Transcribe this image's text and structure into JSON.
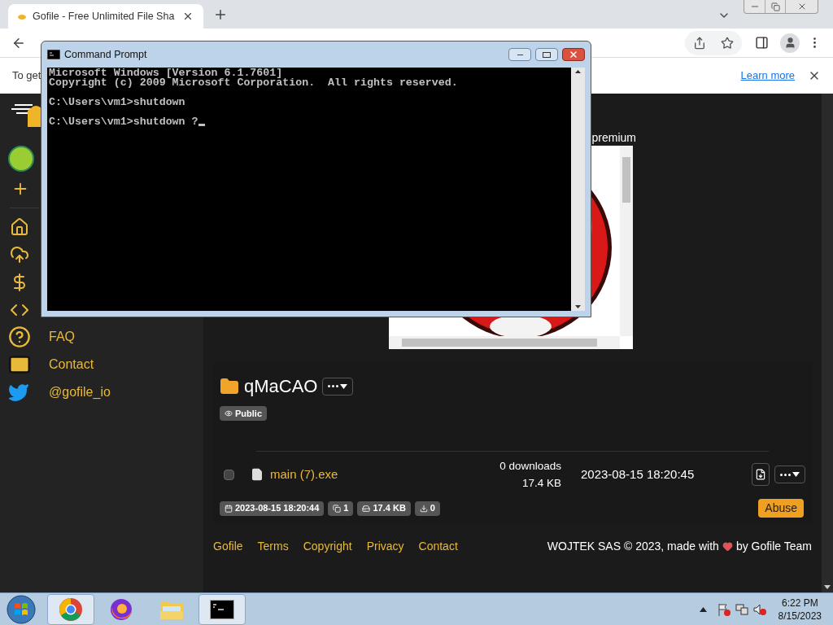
{
  "browser": {
    "tab": {
      "title": "Gofile - Free Unlimited File Sha"
    },
    "infobar": {
      "text": "To get",
      "link": "Learn more"
    }
  },
  "sidebar": {
    "links": [
      {
        "label": "FAQ"
      },
      {
        "label": "Contact"
      },
      {
        "label": "@gofile_io"
      }
    ]
  },
  "page": {
    "premium_text": "premium",
    "folder": {
      "name": "qMaCAO",
      "visibility": "Public"
    },
    "files": [
      {
        "name": "main (7).exe",
        "checked": false,
        "downloads": "0 downloads",
        "size": "17.4 KB",
        "date": "2023-08-15 18:20:45"
      }
    ],
    "stats": [
      "2023-08-15 18:20:44",
      "1",
      "17.4 KB",
      "0"
    ],
    "abuse_button": "Abuse"
  },
  "footer": {
    "links": [
      "Gofile",
      "Terms",
      "Copyright",
      "Privacy",
      "Contact"
    ],
    "credit_before": "WOJTEK SAS © 2023, made with",
    "credit_after": "by Gofile Team"
  },
  "cmd": {
    "title": "Command Prompt",
    "blocks": [
      [
        "Microsoft Windows [Version 6.1.7601]",
        "Copyright (c) 2009 Microsoft Corporation.  All rights reserved."
      ],
      [
        "C:\\Users\\vm1>shutdown"
      ],
      [
        "C:\\Users\\vm1>shutdown ?"
      ]
    ],
    "cursor": true
  },
  "taskbar": {
    "apps": [
      {
        "running": true
      },
      {
        "running": false
      },
      {
        "running": false
      },
      {
        "running": true
      }
    ],
    "time": "6:22 PM",
    "date": "8/15/2023"
  }
}
